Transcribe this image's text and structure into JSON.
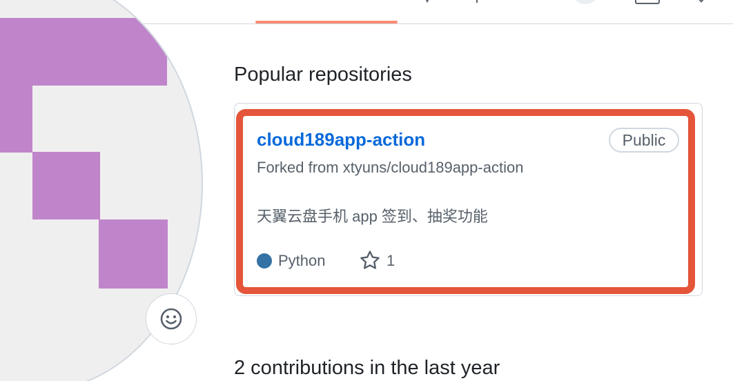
{
  "profile": {
    "avatar_pixel_color": "#c084cb",
    "status_icon": "smiley-icon"
  },
  "tabs": {
    "active_underline_color": "#fd8c73"
  },
  "popular": {
    "heading": "Popular repositories",
    "repos": [
      {
        "name": "cloud189app-action",
        "visibility": "Public",
        "forked_from": "Forked from xtyuns/cloud189app-action",
        "description": "天翼云盘手机 app 签到、抽奖功能",
        "language": "Python",
        "language_color": "#3572a5",
        "stars": "1"
      }
    ],
    "highlight_color": "#e4553a"
  },
  "contributions": {
    "heading": "2 contributions in the last year"
  }
}
